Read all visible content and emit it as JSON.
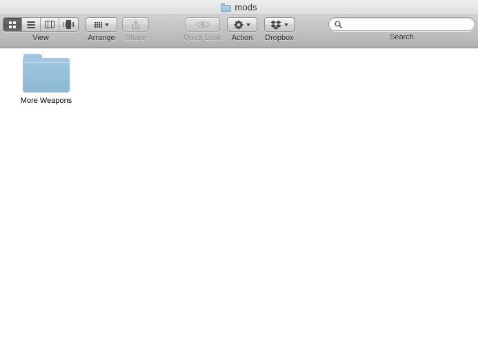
{
  "window": {
    "title": "mods",
    "title_icon": "folder-icon"
  },
  "toolbar": {
    "view": {
      "label": "View",
      "options": [
        {
          "name": "icon-view",
          "icon": "grid-icon",
          "selected": true
        },
        {
          "name": "list-view",
          "icon": "list-icon",
          "selected": false
        },
        {
          "name": "column-view",
          "icon": "columns-icon",
          "selected": false
        },
        {
          "name": "coverflow-view",
          "icon": "coverflow-icon",
          "selected": false
        }
      ]
    },
    "arrange": {
      "label": "Arrange",
      "icon": "grid-dots-icon",
      "disabled": false
    },
    "share": {
      "label": "Share",
      "icon": "share-arrow-icon",
      "disabled": true
    },
    "quick_look": {
      "label": "Quick Look",
      "icon": "eye-icon",
      "disabled": true
    },
    "action": {
      "label": "Action",
      "icon": "gear-icon",
      "disabled": false
    },
    "dropbox": {
      "label": "Dropbox",
      "icon": "dropbox-icon",
      "disabled": false
    },
    "search": {
      "label": "Search",
      "icon": "search-icon",
      "value": "",
      "placeholder": ""
    }
  },
  "content": {
    "items": [
      {
        "name": "More Weapons",
        "icon": "folder-icon",
        "selected": false
      }
    ]
  },
  "colors": {
    "folder_blue": "#8cb8d4",
    "toolbar_top": "#d2d2d2",
    "toolbar_bottom": "#adadad",
    "titlebar_top": "#eeeeee"
  }
}
